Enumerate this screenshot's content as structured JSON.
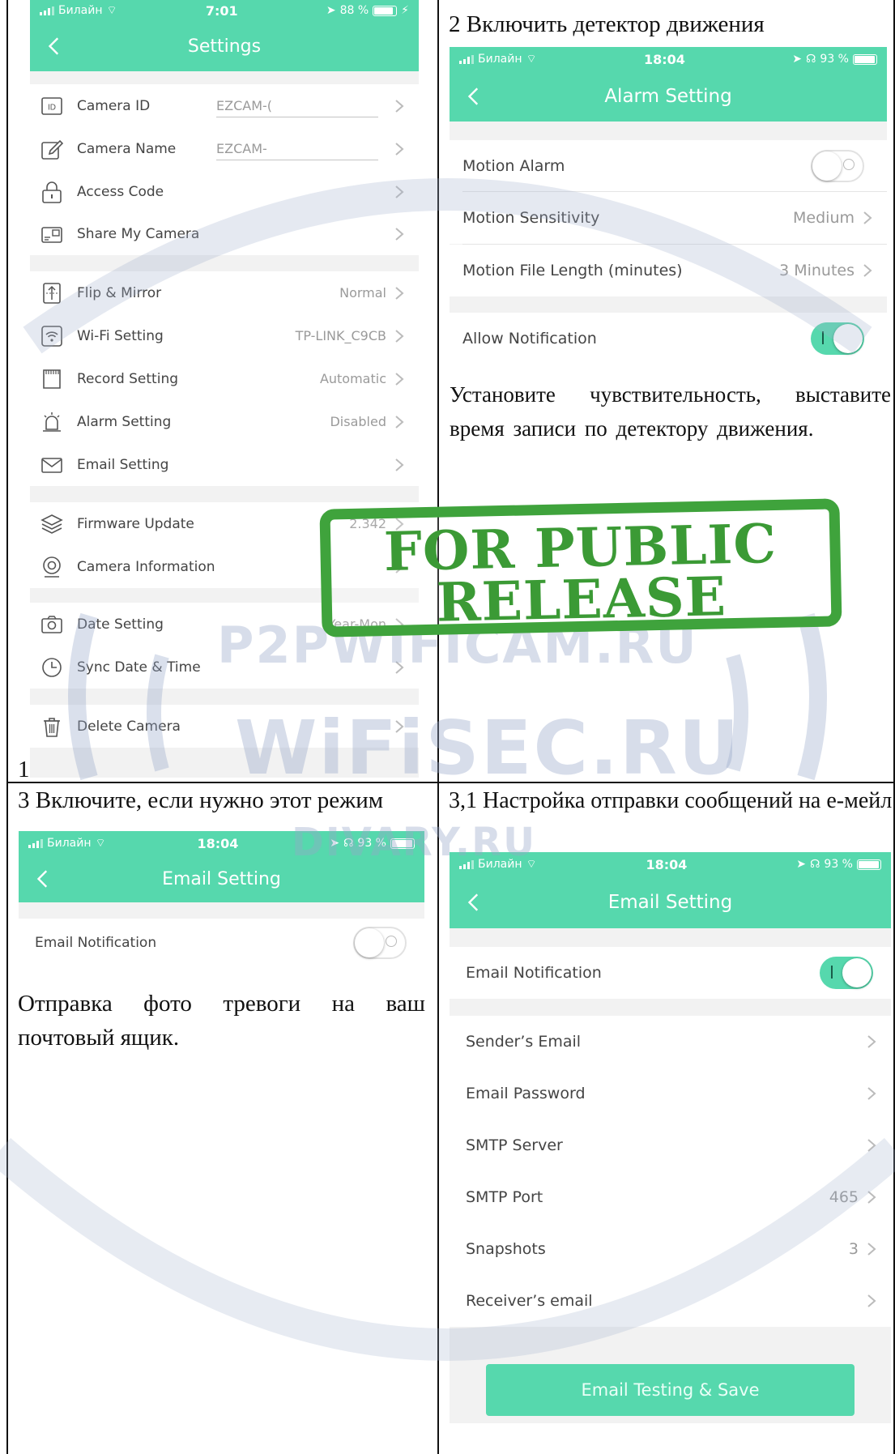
{
  "captions": {
    "c1": "1",
    "c2": "2 Включить детектор движения",
    "c3": "3 Включите, если нужно этот режим",
    "c4": "3,1 Настройка отправки сообщений на е-мейл"
  },
  "body_text": {
    "alarm_hint": "Установите чувствительность, выставите время записи по детектору движения.",
    "email_hint": "Отправка фото тревоги на ваш почтовый ящик."
  },
  "settings_screen": {
    "status": {
      "carrier": "Билайн",
      "time": "7:01",
      "battery": "88 %"
    },
    "title": "Settings",
    "items": [
      {
        "label": "Camera ID",
        "value": "EZCAM-(",
        "icon": "id-icon"
      },
      {
        "label": "Camera Name",
        "value": "EZCAM-",
        "icon": "edit-icon"
      },
      {
        "label": "Access Code",
        "value": "",
        "icon": "lock-icon"
      },
      {
        "label": "Share My Camera",
        "value": "",
        "icon": "share-camera-icon"
      },
      {
        "label": "Flip & Mirror",
        "value": "Normal",
        "icon": "flip-icon"
      },
      {
        "label": "Wi-Fi Setting",
        "value": "TP-LINK_C9CB",
        "icon": "wifi-icon"
      },
      {
        "label": "Record Setting",
        "value": "Automatic",
        "icon": "sd-card-icon"
      },
      {
        "label": "Alarm Setting",
        "value": "Disabled",
        "icon": "alarm-icon"
      },
      {
        "label": "Email Setting",
        "value": "",
        "icon": "mail-icon"
      },
      {
        "label": "Firmware Update",
        "value": "2.342",
        "icon": "layers-icon"
      },
      {
        "label": "Camera Information",
        "value": "",
        "icon": "camera-info-icon"
      },
      {
        "label": "Date Setting",
        "value": "Year-Mon",
        "icon": "camera-date-icon"
      },
      {
        "label": "Sync Date & Time",
        "value": "",
        "icon": "clock-icon"
      },
      {
        "label": "Delete Camera",
        "value": "",
        "icon": "trash-icon"
      }
    ]
  },
  "alarm_screen": {
    "status": {
      "carrier": "Билайн",
      "time": "18:04",
      "battery": "93 %"
    },
    "title": "Alarm Setting",
    "motion_alarm": "Motion Alarm",
    "motion_sensitivity": "Motion Sensitivity",
    "motion_sensitivity_value": "Medium",
    "motion_file_length": "Motion File Length (minutes)",
    "motion_file_length_value": "3 Minutes",
    "allow_notification": "Allow Notification"
  },
  "email_screen_small": {
    "status": {
      "carrier": "Билайн",
      "time": "18:04",
      "battery": "93 %"
    },
    "title": "Email Setting",
    "email_notification": "Email Notification"
  },
  "email_screen_full": {
    "status": {
      "carrier": "Билайн",
      "time": "18:04",
      "battery": "93 %"
    },
    "title": "Email Setting",
    "email_notification": "Email Notification",
    "senders_email": "Sender’s Email",
    "email_password": "Email Password",
    "smtp_server": "SMTP Server",
    "smtp_port": "SMTP Port",
    "smtp_port_value": "465",
    "snapshots": "Snapshots",
    "snapshots_value": "3",
    "receivers_email": "Receiver’s email",
    "save_button": "Email Testing & Save"
  },
  "watermarks": {
    "p2p": "P2PWIFICAM.RU",
    "wifisec": "WiFiSEC.RU",
    "divary": "DIVARY.RU",
    "stamp_line1": "FOR PUBLIC",
    "stamp_line2": "RELEASE"
  },
  "colors": {
    "accent": "#56d8ad",
    "stamp": "#3fa33c",
    "text": "#444444",
    "value": "#9a9a9a"
  }
}
